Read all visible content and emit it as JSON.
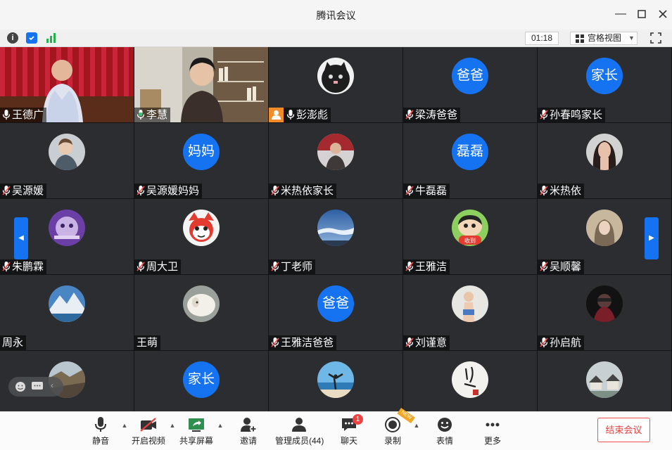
{
  "window": {
    "title": "腾讯会议"
  },
  "subbar": {
    "timer": "01:18",
    "view_label": "宫格视图"
  },
  "colors": {
    "accent": "#1573f2",
    "end": "#e8403f",
    "tile_bg": "#2b2d31",
    "active_border": "#3fc37a"
  },
  "tiles": [
    {
      "name": "王德广",
      "avatar": "video-red-curtain",
      "mic": "on"
    },
    {
      "name": "李慧",
      "avatar": "video-bookshelf",
      "mic": "on-active"
    },
    {
      "name": "彭澎彪",
      "avatar": "photo-cat",
      "mic": "on"
    },
    {
      "name": "梁涛爸爸",
      "avatar_text": "爸爸",
      "mic": "muted"
    },
    {
      "name": "孙春鸣家长",
      "avatar_text": "家长",
      "mic": "muted"
    },
    {
      "name": "吴源媛",
      "avatar": "photo-child",
      "mic": "muted"
    },
    {
      "name": "吴源媛妈妈",
      "avatar_text": "妈妈",
      "mic": "muted"
    },
    {
      "name": "米热依家长",
      "avatar": "photo-man",
      "mic": "muted"
    },
    {
      "name": "牛磊磊",
      "avatar_text": "磊磊",
      "mic": "muted"
    },
    {
      "name": "米热依",
      "avatar": "photo-woman",
      "mic": "muted"
    },
    {
      "name": "朱鹏霖",
      "avatar": "photo-purple",
      "mic": "muted"
    },
    {
      "name": "周大卫",
      "avatar": "photo-red-fox",
      "mic": "muted"
    },
    {
      "name": "丁老师",
      "avatar": "photo-sky",
      "mic": "muted"
    },
    {
      "name": "王雅洁",
      "avatar": "photo-cartoon",
      "mic": "muted"
    },
    {
      "name": "吴顺馨",
      "avatar": "photo-girl",
      "mic": "muted"
    },
    {
      "name": "周永",
      "avatar": "photo-mountain",
      "mic": "none"
    },
    {
      "name": "王萌",
      "avatar": "photo-sheep",
      "mic": "none"
    },
    {
      "name": "王雅洁爸爸",
      "avatar_text": "爸爸",
      "mic": "muted"
    },
    {
      "name": "刘谨意",
      "avatar": "photo-toddler",
      "mic": "muted"
    },
    {
      "name": "孙启航",
      "avatar": "photo-dark",
      "mic": "muted"
    },
    {
      "name": "",
      "avatar": "photo-cliff",
      "mic": "none"
    },
    {
      "name": "",
      "avatar_text": "家长",
      "mic": "none"
    },
    {
      "name": "",
      "avatar": "photo-beach",
      "mic": "none"
    },
    {
      "name": "",
      "avatar": "photo-calligraphy",
      "mic": "none"
    },
    {
      "name": "",
      "avatar": "photo-town",
      "mic": "none"
    }
  ],
  "toolbar": {
    "mute": "静音",
    "video": "开启视频",
    "share": "共享屏幕",
    "invite": "邀请",
    "members": "管理成员(44)",
    "chat": "聊天",
    "chat_badge": "1",
    "record": "录制",
    "record_tag": "NEW",
    "emoji": "表情",
    "more": "更多",
    "end": "结束会议"
  }
}
